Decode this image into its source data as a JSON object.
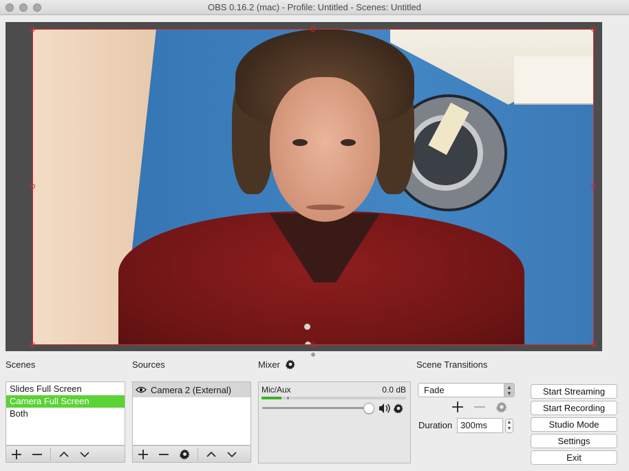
{
  "window": {
    "title": "OBS 0.16.2 (mac) - Profile: Untitled - Scenes: Untitled"
  },
  "scenes": {
    "title": "Scenes",
    "items": [
      {
        "label": "Slides Full Screen",
        "selected": false
      },
      {
        "label": "Camera Full Screen",
        "selected": true
      },
      {
        "label": "Both",
        "selected": false
      }
    ],
    "toolbar": [
      "plus-icon",
      "minus-icon",
      "chevron-up-icon",
      "chevron-down-icon"
    ]
  },
  "sources": {
    "title": "Sources",
    "items": [
      {
        "label": "Camera 2 (External)",
        "visible": true
      }
    ],
    "toolbar": [
      "plus-icon",
      "minus-icon",
      "gear-icon",
      "chevron-up-icon",
      "chevron-down-icon"
    ]
  },
  "mixer": {
    "title": "Mixer",
    "channels": [
      {
        "name": "Mic/Aux",
        "level": "0.0 dB",
        "volume": 0.98
      }
    ]
  },
  "transitions": {
    "title": "Scene Transitions",
    "selected": "Fade",
    "duration_label": "Duration",
    "duration_value": "300ms"
  },
  "controls": {
    "start_streaming": "Start Streaming",
    "start_recording": "Start Recording",
    "studio_mode": "Studio Mode",
    "settings": "Settings",
    "exit": "Exit"
  },
  "colors": {
    "selection_green": "#5bd235",
    "selection_outline": "#d22a2a",
    "meter_green": "#3fb12a"
  }
}
